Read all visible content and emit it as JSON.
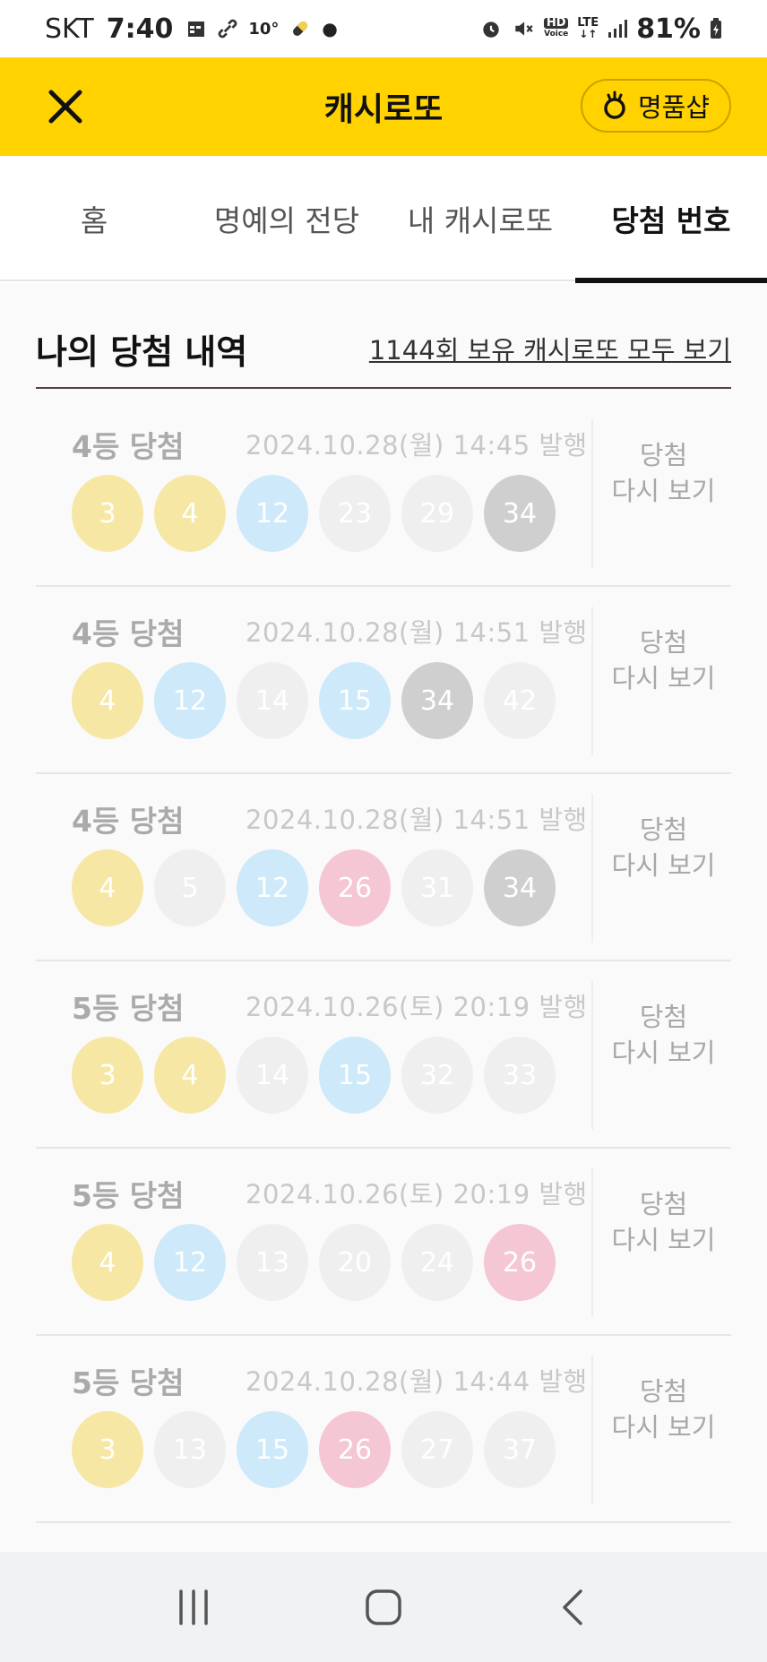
{
  "status": {
    "carrier": "SKT",
    "time": "7:40",
    "temperature": "10°",
    "hd_label": "HD",
    "voice_label": "Voice",
    "lte_label": "LTE",
    "battery": "81%"
  },
  "header": {
    "title": "캐시로또",
    "shop_label": "명품샵"
  },
  "tabs": [
    {
      "label": "홈"
    },
    {
      "label": "명예의 전당"
    },
    {
      "label": "내 캐시로또"
    },
    {
      "label": "당첨 번호"
    }
  ],
  "active_tab": 3,
  "section": {
    "title": "나의 당첨 내역",
    "link": "1144회 보유 캐시로또 모두 보기"
  },
  "wins": [
    {
      "rank": "4등 당첨",
      "date": "2024.10.28(월) 14:45 발행",
      "numbers": [
        "3",
        "4",
        "12",
        "23",
        "29",
        "34"
      ],
      "colors": [
        "yellow",
        "yellow",
        "blue",
        "lightgray",
        "lightgray",
        "gray"
      ],
      "review_line1": "당첨",
      "review_line2": "다시 보기"
    },
    {
      "rank": "4등 당첨",
      "date": "2024.10.28(월) 14:51 발행",
      "numbers": [
        "4",
        "12",
        "14",
        "15",
        "34",
        "42"
      ],
      "colors": [
        "yellow",
        "blue",
        "lightgray",
        "blue",
        "gray",
        "lightgray"
      ],
      "review_line1": "당첨",
      "review_line2": "다시 보기"
    },
    {
      "rank": "4등 당첨",
      "date": "2024.10.28(월) 14:51 발행",
      "numbers": [
        "4",
        "5",
        "12",
        "26",
        "31",
        "34"
      ],
      "colors": [
        "yellow",
        "lightgray",
        "blue",
        "pink",
        "lightgray",
        "gray"
      ],
      "review_line1": "당첨",
      "review_line2": "다시 보기"
    },
    {
      "rank": "5등 당첨",
      "date": "2024.10.26(토) 20:19 발행",
      "numbers": [
        "3",
        "4",
        "14",
        "15",
        "32",
        "33"
      ],
      "colors": [
        "yellow",
        "yellow",
        "lightgray",
        "blue",
        "lightgray",
        "lightgray"
      ],
      "review_line1": "당첨",
      "review_line2": "다시 보기"
    },
    {
      "rank": "5등 당첨",
      "date": "2024.10.26(토) 20:19 발행",
      "numbers": [
        "4",
        "12",
        "13",
        "20",
        "24",
        "26"
      ],
      "colors": [
        "yellow",
        "blue",
        "lightgray",
        "lightgray",
        "lightgray",
        "pink"
      ],
      "review_line1": "당첨",
      "review_line2": "다시 보기"
    },
    {
      "rank": "5등 당첨",
      "date": "2024.10.28(월) 14:44 발행",
      "numbers": [
        "3",
        "13",
        "15",
        "26",
        "27",
        "37"
      ],
      "colors": [
        "yellow",
        "lightgray",
        "blue",
        "pink",
        "lightgray",
        "lightgray"
      ],
      "review_line1": "당첨",
      "review_line2": "다시 보기"
    }
  ],
  "colors": {
    "brand_yellow": "#FFD200",
    "ball_yellow": "#F7E7A4",
    "ball_blue": "#CDE9FA",
    "ball_lightgray": "#EFEFEF",
    "ball_gray": "#CFCFCF",
    "ball_pink": "#F5C6D4"
  }
}
